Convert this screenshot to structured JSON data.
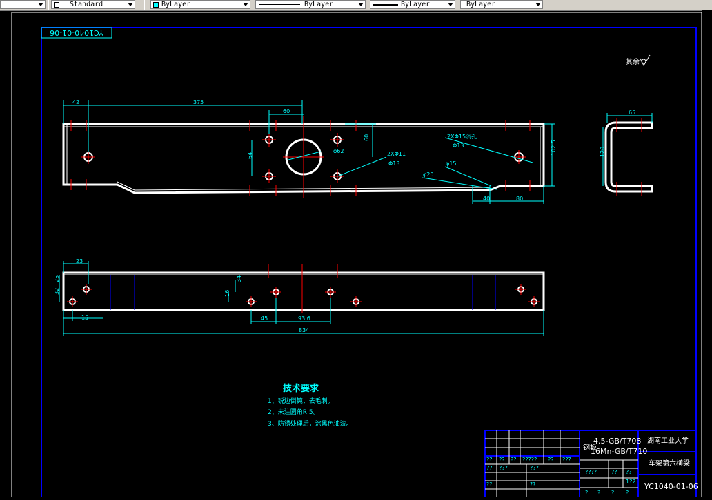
{
  "toolbar": {
    "text_style": "Standard",
    "layer_color": "ByLayer",
    "linetype": "ByLayer",
    "lineweight": "ByLayer",
    "plot_style": "ByLayer",
    "layer_color_swatch": "#00ffff"
  },
  "drawing": {
    "drawing_number_flipped": "YC1040-01-06",
    "roughness_label": "其余",
    "top_view_dims": {
      "d42": "42",
      "d375": "375",
      "d60": "60",
      "d60v": "60",
      "d64": "64",
      "d62": "φ62",
      "d102": "102.5",
      "d40": "40",
      "d80": "80",
      "d20": "φ20",
      "d15": "φ15",
      "hole_note_a": "2XΦ11",
      "hole_note_a2": "Φ13",
      "hole_note_b": "2XΦ15沉孔",
      "hole_note_b2": "Φ13"
    },
    "side_view_dims": {
      "d65": "65",
      "d120": "120"
    },
    "front_view_dims": {
      "d23": "23",
      "d25": "25",
      "d32": "32",
      "d34": "34",
      "d16": "16",
      "d15": "15",
      "d45": "45",
      "d936": "93.6",
      "d834": "834"
    },
    "tech_req": {
      "title": "技术要求",
      "items": [
        "1、锐边倒钝，去毛刺。",
        "2、未注圆角R 5。",
        "3、防锈处理后，涂黑色油漆。"
      ]
    },
    "title_block": {
      "material_line1": "4.5-GB/T708",
      "material_line2": "16Mn-GB/T710",
      "material_prefix": "钢板",
      "school": "湖南工业大学",
      "part_name": "车架第六横梁",
      "drawing_number": "YC1040-01-06",
      "row_a": [
        "??",
        "??",
        "??",
        "?????",
        "??",
        "???"
      ],
      "row_b": [
        "??",
        "???",
        "???"
      ],
      "row_c": [
        "????",
        "??",
        "??"
      ],
      "scale": "1?2",
      "row_d": [
        "??",
        "??"
      ],
      "row_e": [
        "?",
        "?",
        "?",
        "?"
      ]
    }
  }
}
